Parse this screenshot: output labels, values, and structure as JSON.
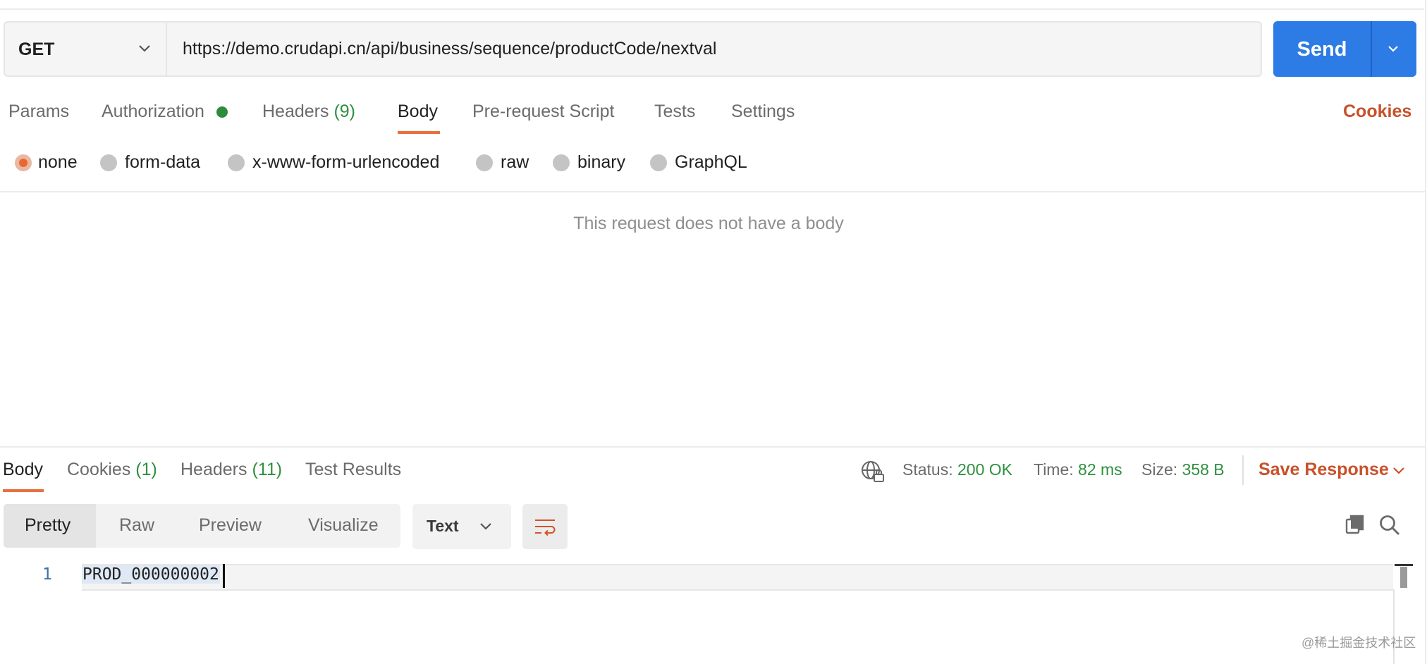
{
  "request": {
    "method": "GET",
    "url": "https://demo.crudapi.cn/api/business/sequence/productCode/nextval",
    "send_label": "Send"
  },
  "request_tabs": {
    "params": "Params",
    "authorization": "Authorization",
    "headers": "Headers",
    "headers_count": "(9)",
    "body": "Body",
    "pre_request": "Pre-request Script",
    "tests": "Tests",
    "settings": "Settings",
    "cookies": "Cookies",
    "active": "Body"
  },
  "body_types": {
    "selected": "none",
    "options": [
      "none",
      "form-data",
      "x-www-form-urlencoded",
      "raw",
      "binary",
      "GraphQL"
    ]
  },
  "no_body_message": "This request does not have a body",
  "response": {
    "tabs": {
      "body": "Body",
      "cookies": "Cookies",
      "cookies_count": "(1)",
      "headers": "Headers",
      "headers_count": "(11)",
      "test_results": "Test Results",
      "active": "Body"
    },
    "status_label": "Status:",
    "status_value": "200 OK",
    "time_label": "Time:",
    "time_value": "82 ms",
    "size_label": "Size:",
    "size_value": "358 B",
    "save_response": "Save Response",
    "views": [
      "Pretty",
      "Raw",
      "Preview",
      "Visualize"
    ],
    "active_view": "Pretty",
    "format": "Text",
    "lines": [
      {
        "number": "1",
        "text": "PROD_000000002"
      }
    ]
  },
  "watermark": "@稀土掘金技术社区",
  "colors": {
    "accent_blue": "#2d7be4",
    "accent_orange": "#e8703f",
    "success_green": "#2f8f3f",
    "link_orange": "#c8512a"
  },
  "icons": [
    "chevron-down-icon",
    "globe-lock-icon",
    "wrap-lines-icon",
    "copy-icon",
    "search-icon"
  ]
}
